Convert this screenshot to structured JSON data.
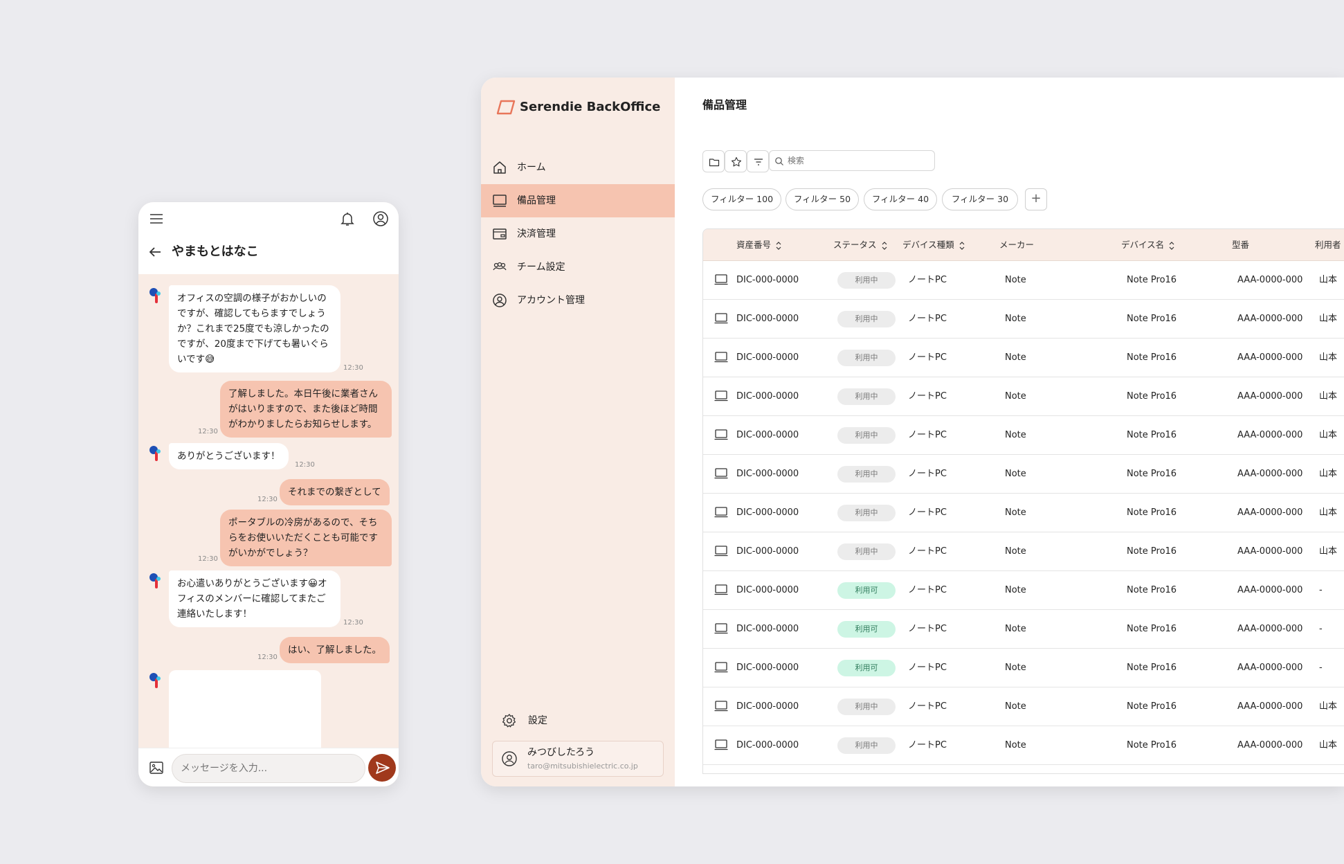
{
  "mobile": {
    "chat_title": "やまもとはなこ",
    "messages": [
      {
        "side": "in",
        "text": "オフィスの空調の様子がおかしいのですが、確認してもらますでしょうか？これまで25度でも涼しかったのですが、20度まで下げても暑いぐらいです😅",
        "time": "12:30"
      },
      {
        "side": "out",
        "text": "了解しました。本日午後に業者さんがはいりますので、また後ほど時間がわかりましたらお知らせします。",
        "time": "12:30"
      },
      {
        "side": "in",
        "text": "ありがとうございます！",
        "time": "12:30"
      },
      {
        "side": "out",
        "text": "それまでの繋ぎとして",
        "time": "12:30"
      },
      {
        "side": "out",
        "text": "ポータブルの冷房があるので、そちらをお使いいただくことも可能ですがいかがでしょう？",
        "time": "12:30"
      },
      {
        "side": "in",
        "text": "お心遣いありがとうございます😀オフィスのメンバーに確認してまたご連絡いたします！",
        "time": "12:30"
      },
      {
        "side": "out",
        "text": "はい、了解しました。",
        "time": "12:30"
      }
    ],
    "input_placeholder": "メッセージを入力..."
  },
  "desktop": {
    "brand": "Serendie BackOffice",
    "nav": [
      {
        "label": "ホーム",
        "icon": "home-icon",
        "active": false
      },
      {
        "label": "備品管理",
        "icon": "monitor-icon",
        "active": true
      },
      {
        "label": "決済管理",
        "icon": "wallet-icon",
        "active": false
      },
      {
        "label": "チーム設定",
        "icon": "team-icon",
        "active": false
      },
      {
        "label": "アカウント管理",
        "icon": "account-icon",
        "active": false
      }
    ],
    "settings_label": "設定",
    "user": {
      "name": "みつびしたろう",
      "email": "taro@mitsubishielectric.co.jp"
    },
    "page_title": "備品管理",
    "search_placeholder": "検索",
    "filters": [
      "フィルター 100",
      "フィルター 50",
      "フィルター 40",
      "フィルター 30"
    ],
    "add_filter": "+",
    "columns": [
      "資産番号",
      "ステータス",
      "デバイス種類",
      "メーカー",
      "デバイス名",
      "型番",
      "利用者"
    ],
    "rows": [
      [
        "DIC-000-0000",
        "利用中",
        "ノートPC",
        "Note",
        "Note Pro16",
        "AAA-0000-000",
        "山本"
      ],
      [
        "DIC-000-0000",
        "利用中",
        "ノートPC",
        "Note",
        "Note Pro16",
        "AAA-0000-000",
        "山本"
      ],
      [
        "DIC-000-0000",
        "利用中",
        "ノートPC",
        "Note",
        "Note Pro16",
        "AAA-0000-000",
        "山本"
      ],
      [
        "DIC-000-0000",
        "利用中",
        "ノートPC",
        "Note",
        "Note Pro16",
        "AAA-0000-000",
        "山本"
      ],
      [
        "DIC-000-0000",
        "利用中",
        "ノートPC",
        "Note",
        "Note Pro16",
        "AAA-0000-000",
        "山本"
      ],
      [
        "DIC-000-0000",
        "利用中",
        "ノートPC",
        "Note",
        "Note Pro16",
        "AAA-0000-000",
        "山本"
      ],
      [
        "DIC-000-0000",
        "利用中",
        "ノートPC",
        "Note",
        "Note Pro16",
        "AAA-0000-000",
        "山本"
      ],
      [
        "DIC-000-0000",
        "利用中",
        "ノートPC",
        "Note",
        "Note Pro16",
        "AAA-0000-000",
        "山本"
      ],
      [
        "DIC-000-0000",
        "利用可",
        "ノートPC",
        "Note",
        "Note Pro16",
        "AAA-0000-000",
        "-"
      ],
      [
        "DIC-000-0000",
        "利用可",
        "ノートPC",
        "Note",
        "Note Pro16",
        "AAA-0000-000",
        "-"
      ],
      [
        "DIC-000-0000",
        "利用可",
        "ノートPC",
        "Note",
        "Note Pro16",
        "AAA-0000-000",
        "-"
      ],
      [
        "DIC-000-0000",
        "利用中",
        "ノートPC",
        "Note",
        "Note Pro16",
        "AAA-0000-000",
        "山本"
      ],
      [
        "DIC-000-0000",
        "利用中",
        "ノートPC",
        "Note",
        "Note Pro16",
        "AAA-0000-000",
        "山本"
      ]
    ]
  },
  "colors": {
    "accent": "#f6c4b0",
    "panel": "#f9ece5",
    "send": "#a0391c",
    "available": "#cdf5e4"
  }
}
